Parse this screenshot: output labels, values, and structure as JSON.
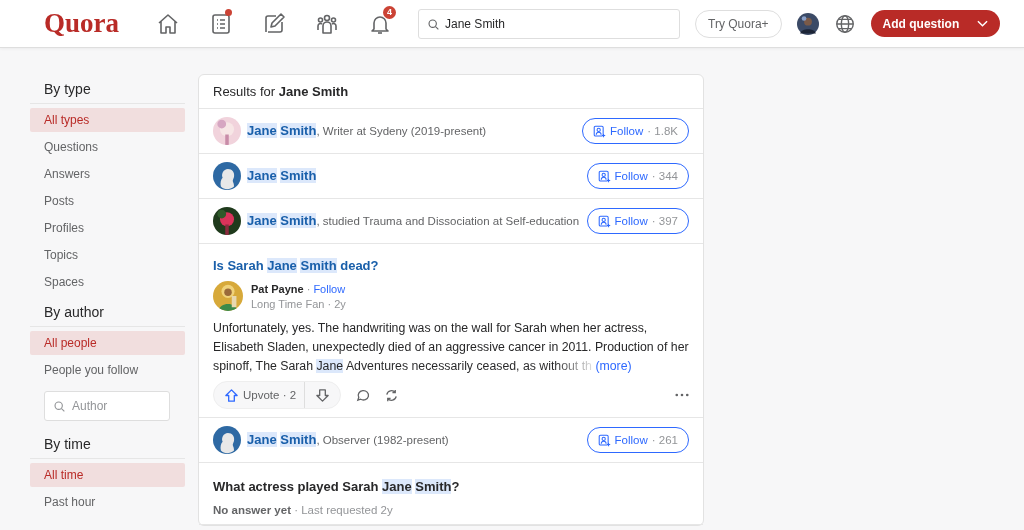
{
  "header": {
    "logo": "Quora",
    "nav": [
      {
        "dot": false
      },
      {
        "dot": true
      },
      {
        "dot": false
      },
      {
        "dot": false
      },
      {
        "dot": false,
        "badge": "4"
      }
    ],
    "search": {
      "value": "Jane Smith"
    },
    "try_plus": "Try Quora+",
    "add_question": "Add question"
  },
  "sidebar": [
    {
      "title": "By type",
      "items": [
        {
          "label": "All types",
          "selected": true
        },
        {
          "label": "Questions",
          "selected": false
        },
        {
          "label": "Answers",
          "selected": false
        },
        {
          "label": "Posts",
          "selected": false
        },
        {
          "label": "Profiles",
          "selected": false
        },
        {
          "label": "Topics",
          "selected": false
        },
        {
          "label": "Spaces",
          "selected": false
        }
      ]
    },
    {
      "title": "By author",
      "items": [
        {
          "label": "All people",
          "selected": true
        },
        {
          "label": "People you follow",
          "selected": false
        }
      ],
      "search_placeholder": "Author"
    },
    {
      "title": "By time",
      "items": [
        {
          "label": "All time",
          "selected": true
        },
        {
          "label": "Past hour",
          "selected": false
        }
      ]
    }
  ],
  "results": {
    "heading": "Results for **Jane Smith**",
    "items": [
      {
        "kind": "profile",
        "default_avatar": false,
        "name": [
          {
            "text": "Jane ",
            "highlight": true
          },
          {
            "text": "Smith",
            "highlight": true
          }
        ],
        "description": ", Writer at Sydeny (2019-present)",
        "follow": "Follow",
        "count": "· 1.8K"
      },
      {
        "kind": "profile",
        "default_avatar": true,
        "name": [
          {
            "text": "Jane ",
            "highlight": true
          },
          {
            "text": "Smith",
            "highlight": true
          }
        ],
        "follow": "Follow",
        "count": "· 344"
      },
      {
        "kind": "profile",
        "default_avatar": false,
        "name": [
          {
            "text": "Jane ",
            "highlight": true
          },
          {
            "text": "Smith",
            "highlight": true
          }
        ],
        "description": ", studied Trauma and Dissociation at Self-education",
        "follow": "Follow",
        "count": "· 397"
      },
      {
        "kind": "answer",
        "question": [
          {
            "text": "Is Sarah ",
            "highlight": false
          },
          {
            "text": "Jane ",
            "highlight": true
          },
          {
            "text": "Smith",
            "highlight": true
          },
          {
            "text": " dead?",
            "highlight": false
          }
        ],
        "author": "Pat Payne",
        "separator": "·",
        "author_follow": "Follow",
        "credential": "Long Time Fan · 2y",
        "body": [
          {
            "text": "Unfortunately, yes. The handwriting was on the wall for Sarah when her actress, Elisabeth Sladen, unexpectedly died of an aggressive cancer in 2011. Production of her spinoff, The Sarah ",
            "highlight": false
          },
          {
            "text": "Jane",
            "highlight": true
          },
          {
            "text": " Adventures necessarily ceased, as without th",
            "highlight": false
          }
        ],
        "more": "(more)",
        "upvote": "Upvote · 2"
      },
      {
        "kind": "profile",
        "default_avatar": true,
        "name": [
          {
            "text": "Jane ",
            "highlight": true
          },
          {
            "text": "Smith",
            "highlight": true
          }
        ],
        "description": ", Observer (1982-present)",
        "follow": "Follow",
        "count": "· 261"
      },
      {
        "kind": "question",
        "question": [
          {
            "text": "What actress played Sarah ",
            "highlight": false
          },
          {
            "text": "Jane ",
            "highlight": true
          },
          {
            "text": "Smith",
            "highlight": true
          },
          {
            "text": "?",
            "highlight": false
          }
        ],
        "status": "No answer yet",
        "meta": " · Last requested 2y"
      }
    ]
  }
}
